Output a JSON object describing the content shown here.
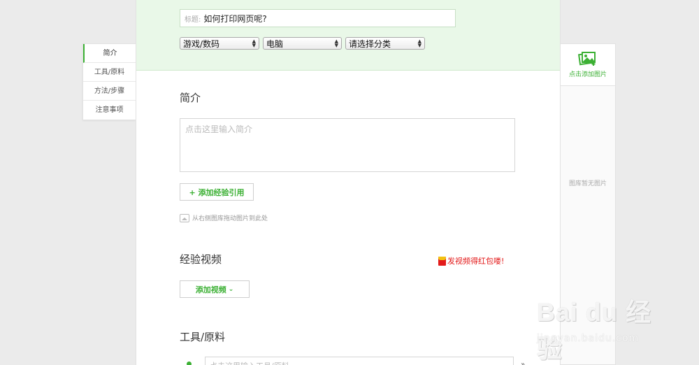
{
  "nav": {
    "items": [
      {
        "label": "简介"
      },
      {
        "label": "工具/原料"
      },
      {
        "label": "方法/步骤"
      },
      {
        "label": "注意事项"
      }
    ]
  },
  "header": {
    "title_label": "标题:",
    "title_value": "如何打印网页呢?",
    "categories": [
      {
        "selected": "游戏/数码"
      },
      {
        "selected": "电脑"
      },
      {
        "selected": "请选择分类"
      }
    ]
  },
  "intro": {
    "heading": "简介",
    "placeholder": "点击这里输入简介",
    "add_reference_label": "+ 添加经验引用",
    "drag_hint": "从右侧图库拖动图片到此处"
  },
  "video": {
    "heading": "经验视频",
    "promo": "发视频得红包喽!",
    "add_video_label": "添加视频"
  },
  "tools": {
    "heading": "工具/原料",
    "placeholder": "点击这里输入工具/原料"
  },
  "gallery": {
    "add_image_label": "点击添加图片",
    "empty_text": "图库暂无图片"
  },
  "watermark": {
    "brand": "Bai du 经验",
    "url": "jingyan.baidu.com"
  },
  "colors": {
    "accent": "#3cb034",
    "top_band": "#e9f8e8",
    "promo_red": "#e31b1b"
  }
}
